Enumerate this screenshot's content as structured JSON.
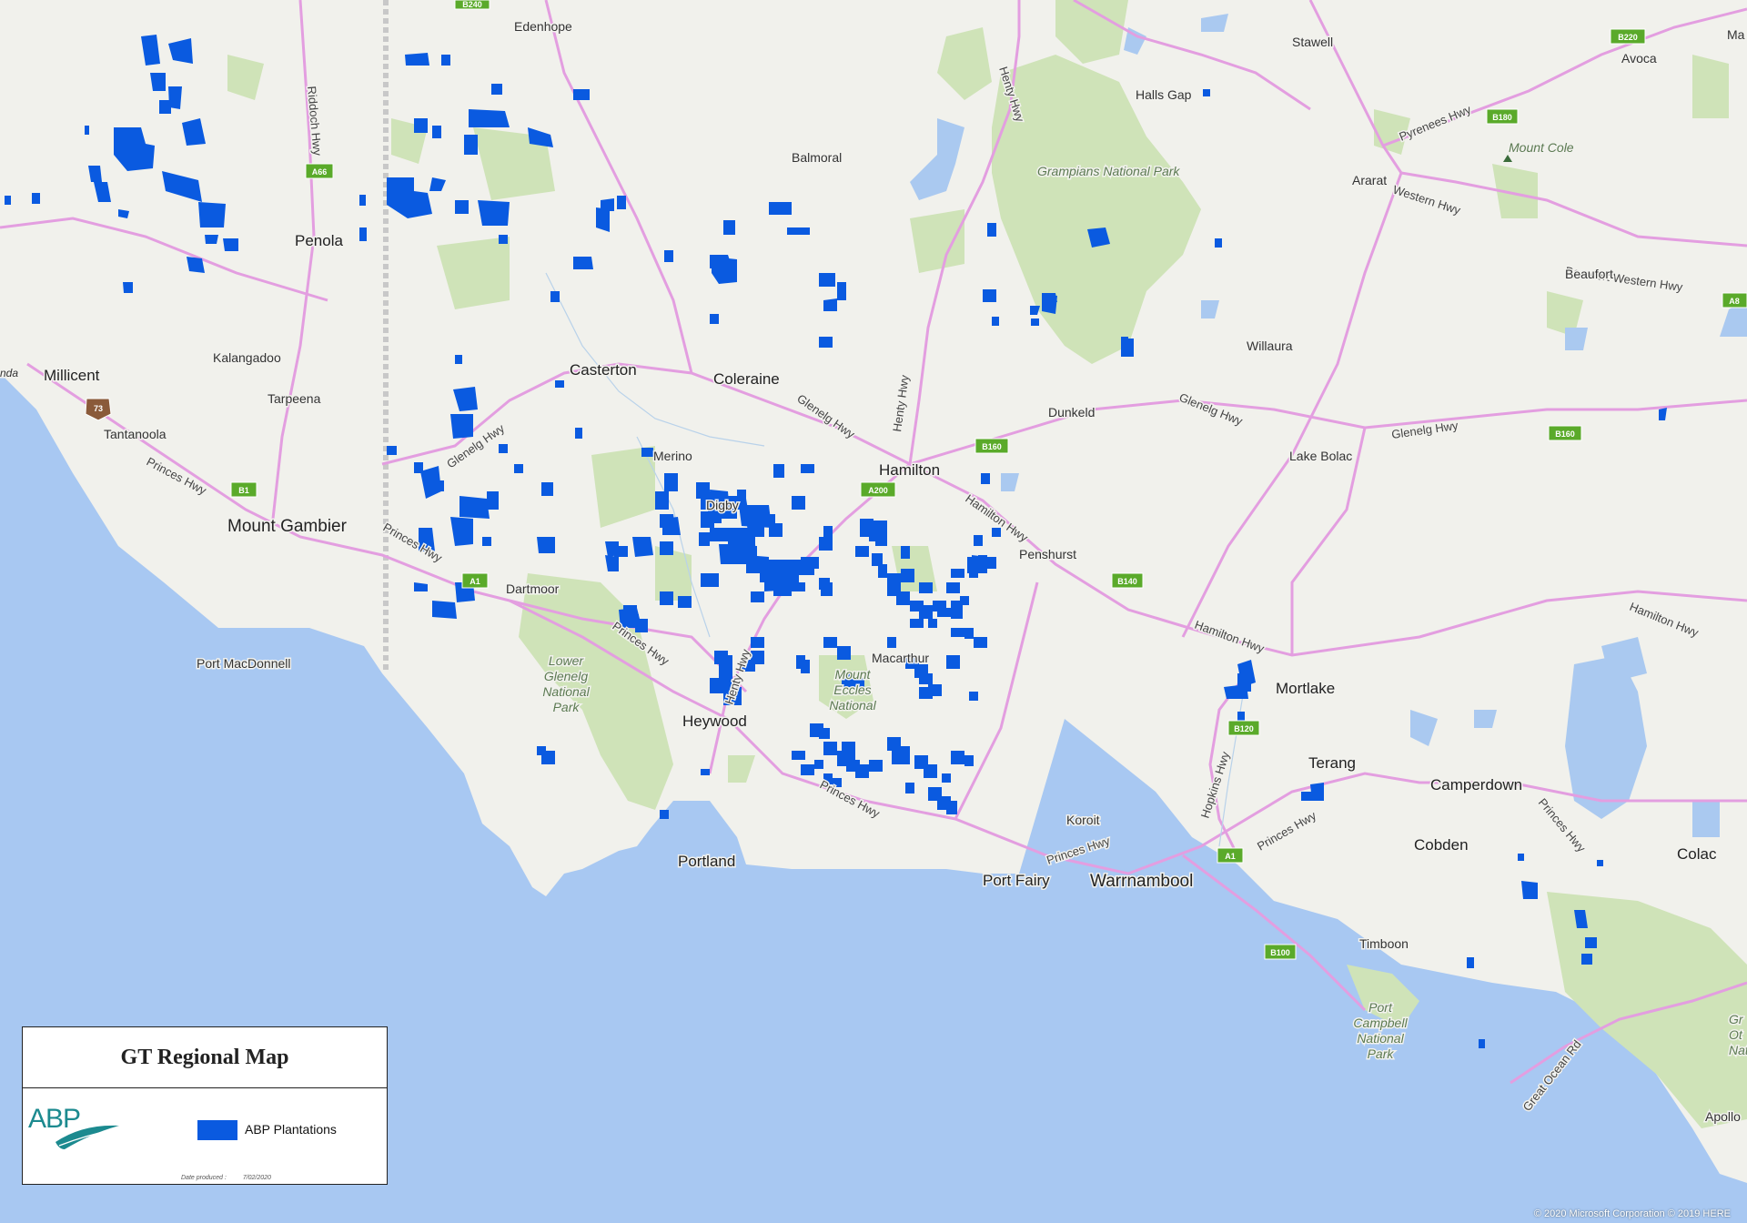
{
  "legend": {
    "title": "GT Regional Map",
    "logo_text": "ABP",
    "item_label": "ABP Plantations",
    "date_label": "Date produced :",
    "date_value": "7/02/2020"
  },
  "copyright": "© 2020 Microsoft Corporation © 2019 HERE",
  "colors": {
    "sea": "#a8c8f2",
    "land": "#f1f1ec",
    "park": "#cfe3b8",
    "lake": "#aac9f0",
    "plantation": "#0a5ae0",
    "highway": "#e39ee0",
    "shield": "#5aaa2a"
  },
  "places": [
    {
      "name": "Edenhope"
    },
    {
      "name": "Stawell"
    },
    {
      "name": "Avoca"
    },
    {
      "name": "Ma"
    },
    {
      "name": "Halls Gap"
    },
    {
      "name": "Balmoral"
    },
    {
      "name": "Ararat"
    },
    {
      "name": "Penola"
    },
    {
      "name": "Beaufort"
    },
    {
      "name": "Willaura"
    },
    {
      "name": "Kalangadoo"
    },
    {
      "name": "Millicent"
    },
    {
      "name": "Casterton"
    },
    {
      "name": "Coleraine"
    },
    {
      "name": "Tarpeena"
    },
    {
      "name": "Dunkeld"
    },
    {
      "name": "Tantanoola"
    },
    {
      "name": "Merino"
    },
    {
      "name": "Lake Bolac"
    },
    {
      "name": "Hamilton"
    },
    {
      "name": "Digby"
    },
    {
      "name": "Mount Gambier"
    },
    {
      "name": "Penshurst"
    },
    {
      "name": "Dartmoor"
    },
    {
      "name": "Macarthur"
    },
    {
      "name": "Mortlake"
    },
    {
      "name": "Port MacDonnell"
    },
    {
      "name": "Heywood"
    },
    {
      "name": "Terang"
    },
    {
      "name": "Camperdown"
    },
    {
      "name": "Koroit"
    },
    {
      "name": "Cobden"
    },
    {
      "name": "Colac"
    },
    {
      "name": "Portland"
    },
    {
      "name": "Port Fairy"
    },
    {
      "name": "Warrnambool"
    },
    {
      "name": "Timboon"
    },
    {
      "name": "Apollo"
    },
    {
      "name": "nda"
    }
  ],
  "parks": [
    "Grampians National Park",
    "Mount Cole",
    "Lower Glenelg National Park",
    "Mount Eccles National",
    "Port Campbell National Park",
    "Gr Ot Nat"
  ],
  "highways": [
    "Riddoch Hwy",
    "Henty Hwy",
    "Pyrenees Hwy",
    "Western Hwy",
    "Beaufort Western Hwy",
    "Glenelg Hwy",
    "Princes Hwy",
    "Hamilton Hwy",
    "Hopkins Hwy",
    "Great Ocean Rd"
  ],
  "shields": [
    "B240",
    "B220",
    "A66",
    "B180",
    "A8",
    "73",
    "B1",
    "B160",
    "A200",
    "B160",
    "A1",
    "B140",
    "B120",
    "A1",
    "B100"
  ]
}
